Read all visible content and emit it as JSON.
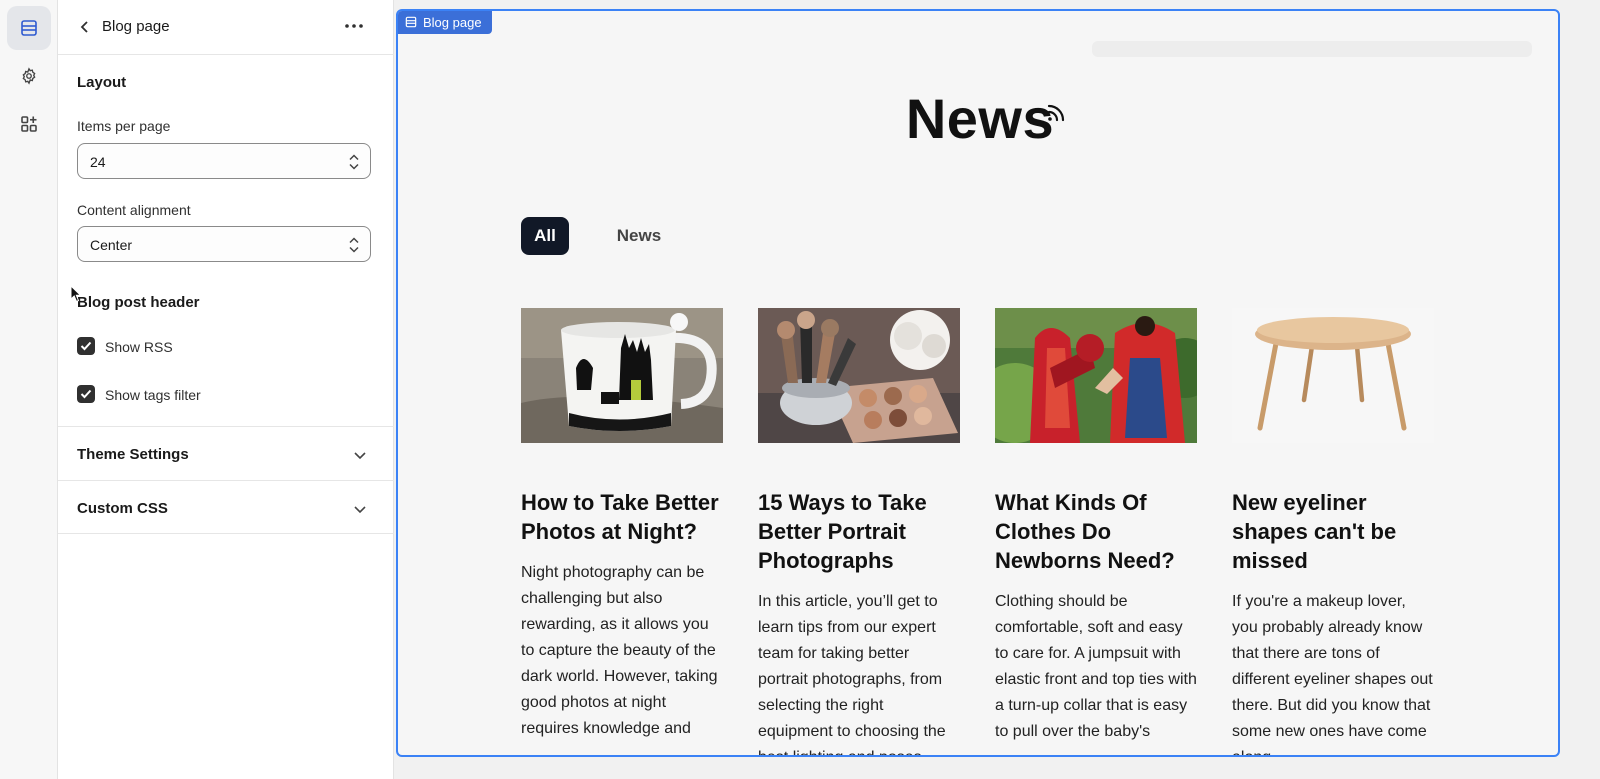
{
  "panel": {
    "title": "Blog page",
    "layout_title": "Layout",
    "items_per_page_label": "Items per page",
    "items_per_page_value": "24",
    "content_alignment_label": "Content alignment",
    "content_alignment_value": "Center",
    "blog_post_header_title": "Blog post header",
    "show_rss_label": "Show RSS",
    "show_tags_filter_label": "Show tags filter",
    "theme_settings_label": "Theme Settings",
    "custom_css_label": "Custom CSS"
  },
  "preview": {
    "section_tag": "Blog page",
    "heading": "News",
    "tags": [
      "All",
      "News"
    ],
    "cards": [
      {
        "title": "How to Take Better Photos at Night?",
        "excerpt": "Night photography can be challenging but also rewarding, as it allows you to capture the beauty of the dark world. However, taking good photos at night requires knowledge and"
      },
      {
        "title": "15 Ways to Take Better Portrait Photographs",
        "excerpt": "In this article, you’ll get to learn tips from our expert team for taking better portrait photographs, from selecting the right equipment to choosing the best lighting and poses"
      },
      {
        "title": "What Kinds Of Clothes Do Newborns Need?",
        "excerpt": "Clothing should be comfortable, soft and easy to care for. A jumpsuit with elastic front and top ties with a turn-up collar that is easy to pull over the baby's"
      },
      {
        "title": "New eyeliner shapes can't be missed",
        "excerpt": "If you're a makeup lover, you probably already know that there are tons of different eyeliner shapes out there. But did you know that some new ones have come along"
      }
    ]
  }
}
